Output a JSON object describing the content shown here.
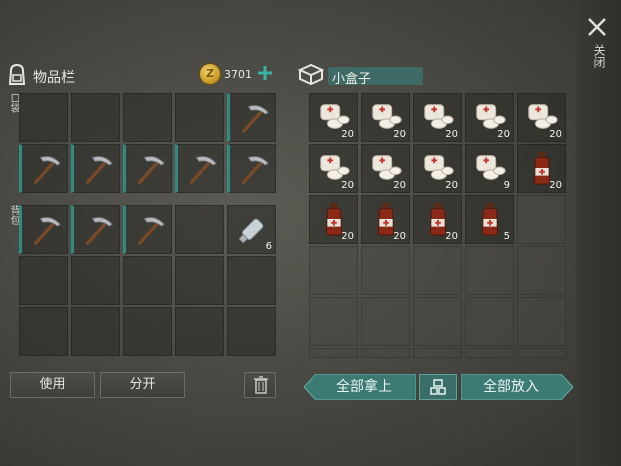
{
  "inventory": {
    "title": "物品栏",
    "coins": "3701",
    "section_pocket": "口袋",
    "section_backpack": "背包",
    "bottle_count": "6"
  },
  "box": {
    "title": "小盒子",
    "counts": [
      "20",
      "20",
      "20",
      "20",
      "20",
      "20",
      "20",
      "20",
      "9",
      "20",
      "20",
      "20",
      "20",
      "5"
    ]
  },
  "buttons": {
    "use": "使用",
    "split": "分开",
    "take_all": "全部拿上",
    "put_all": "全部放入",
    "close": "关闭"
  },
  "colors": {
    "accent": "#3f6a66",
    "teal_button": "#3c7a74"
  }
}
